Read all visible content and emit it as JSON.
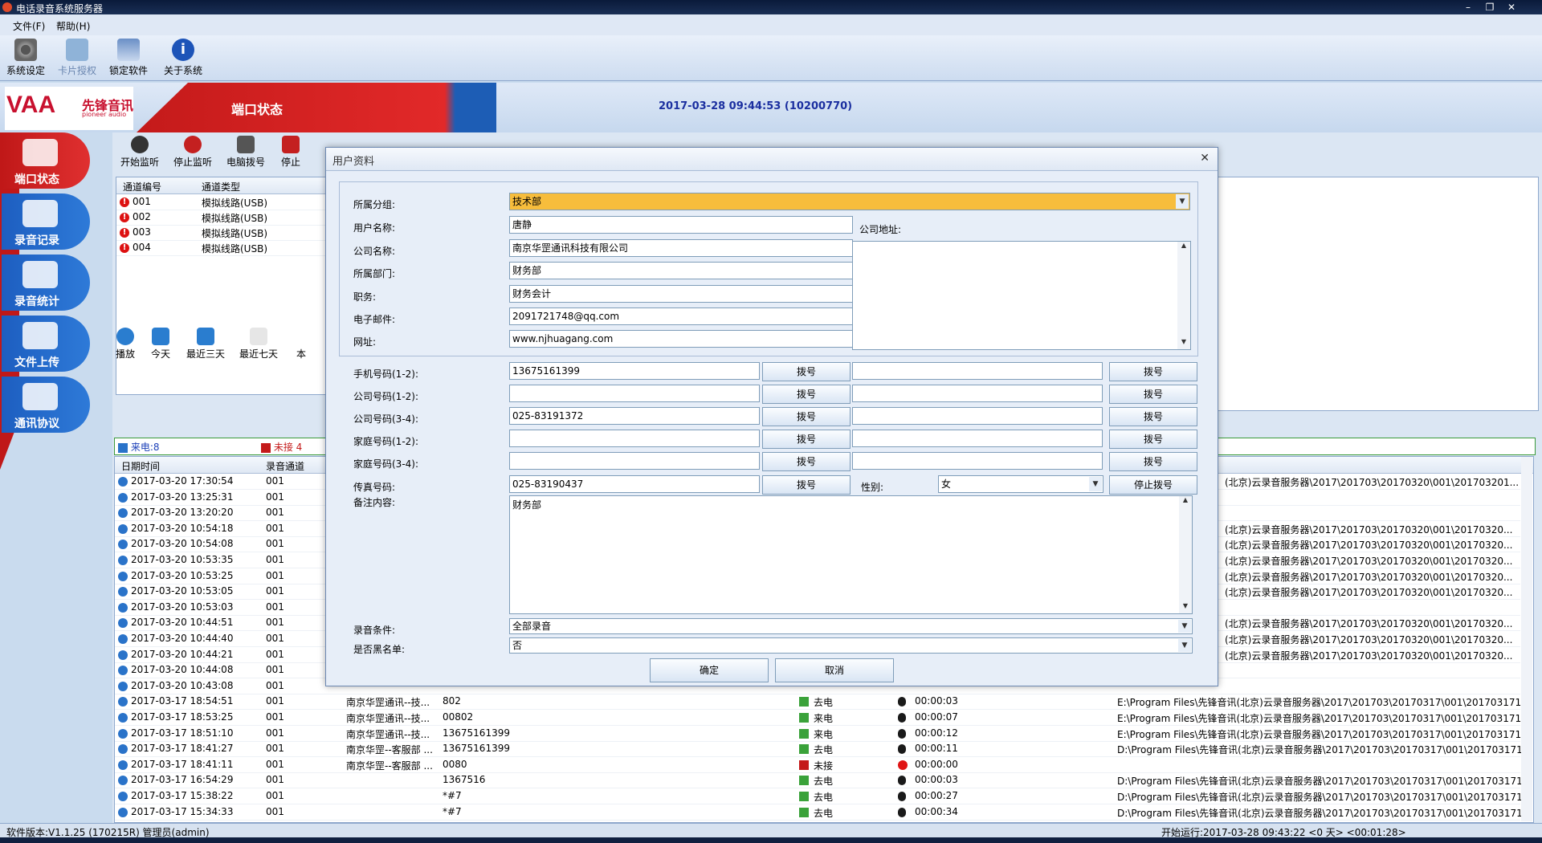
{
  "window": {
    "title": "电话录音系统服务器"
  },
  "menu": [
    "文件(F)",
    "帮助(H)"
  ],
  "toolbar": [
    {
      "label": "系统设定",
      "icon": "gear-icon",
      "enabled": true
    },
    {
      "label": "卡片授权",
      "icon": "card-icon",
      "enabled": false
    },
    {
      "label": "锁定软件",
      "icon": "lock-icon",
      "enabled": true
    },
    {
      "label": "关于系统",
      "icon": "info-icon",
      "enabled": true
    }
  ],
  "banner": {
    "logo": {
      "brand": "VAA",
      "cn": "先锋音讯",
      "en": "pioneer audio"
    },
    "title": "端口状态",
    "datetime": "2017-03-28 09:44:53 (10200770)"
  },
  "leftnav": [
    "端口状态",
    "录音记录",
    "录音统计",
    "文件上传",
    "通讯协议"
  ],
  "port_tools": [
    "开始监听",
    "停止监听",
    "电脑拨号",
    "停止"
  ],
  "channels": {
    "headers": [
      "通道编号",
      "通道类型"
    ],
    "rows": [
      {
        "id": "001",
        "type": "模拟线路(USB)"
      },
      {
        "id": "002",
        "type": "模拟线路(USB)"
      },
      {
        "id": "003",
        "type": "模拟线路(USB)"
      },
      {
        "id": "004",
        "type": "模拟线路(USB)"
      }
    ]
  },
  "record_tools": [
    "播放",
    "今天",
    "最近三天",
    "最近七天",
    "本"
  ],
  "record_filter": {
    "incoming": "来电:8",
    "missed": "未接 4"
  },
  "records": {
    "headers": [
      "日期时间",
      "录音通道"
    ],
    "rows": [
      {
        "dt": "2017-03-20 17:30:54",
        "ch": "001",
        "path": "(北京)云录音服务器\\2017\\201703\\20170320\\001\\201703201..."
      },
      {
        "dt": "2017-03-20 13:25:31",
        "ch": "001",
        "path": ""
      },
      {
        "dt": "2017-03-20 13:20:20",
        "ch": "001",
        "path": ""
      },
      {
        "dt": "2017-03-20 10:54:18",
        "ch": "001",
        "path": "(北京)云录音服务器\\2017\\201703\\20170320\\001\\20170320..."
      },
      {
        "dt": "2017-03-20 10:54:08",
        "ch": "001",
        "path": "(北京)云录音服务器\\2017\\201703\\20170320\\001\\20170320..."
      },
      {
        "dt": "2017-03-20 10:53:35",
        "ch": "001",
        "path": "(北京)云录音服务器\\2017\\201703\\20170320\\001\\20170320..."
      },
      {
        "dt": "2017-03-20 10:53:25",
        "ch": "001",
        "path": "(北京)云录音服务器\\2017\\201703\\20170320\\001\\20170320..."
      },
      {
        "dt": "2017-03-20 10:53:05",
        "ch": "001",
        "path": "(北京)云录音服务器\\2017\\201703\\20170320\\001\\20170320..."
      },
      {
        "dt": "2017-03-20 10:53:03",
        "ch": "001",
        "path": ""
      },
      {
        "dt": "2017-03-20 10:44:51",
        "ch": "001",
        "path": "(北京)云录音服务器\\2017\\201703\\20170320\\001\\20170320..."
      },
      {
        "dt": "2017-03-20 10:44:40",
        "ch": "001",
        "path": "(北京)云录音服务器\\2017\\201703\\20170320\\001\\20170320..."
      },
      {
        "dt": "2017-03-20 10:44:21",
        "ch": "001",
        "path": "(北京)云录音服务器\\2017\\201703\\20170320\\001\\20170320..."
      },
      {
        "dt": "2017-03-20 10:44:08",
        "ch": "001",
        "path": ""
      },
      {
        "dt": "2017-03-20 10:43:08",
        "ch": "001",
        "path": ""
      },
      {
        "dt": "2017-03-17 18:54:51",
        "ch": "001",
        "contact": "南京华罡通讯--技...",
        "num": "802",
        "dir": "去电",
        "dur": "00:00:03",
        "path": "E:\\Program Files\\先锋音讯(北京)云录音服务器\\2017\\201703\\20170317\\001\\201703171..."
      },
      {
        "dt": "2017-03-17 18:53:25",
        "ch": "001",
        "contact": "南京华罡通讯--技...",
        "num": "00802",
        "dir": "来电",
        "dur": "00:00:07",
        "path": "E:\\Program Files\\先锋音讯(北京)云录音服务器\\2017\\201703\\20170317\\001\\201703171..."
      },
      {
        "dt": "2017-03-17 18:51:10",
        "ch": "001",
        "contact": "南京华罡通讯--技...",
        "num": "13675161399",
        "dir": "来电",
        "dur": "00:00:12",
        "path": "E:\\Program Files\\先锋音讯(北京)云录音服务器\\2017\\201703\\20170317\\001\\201703171..."
      },
      {
        "dt": "2017-03-17 18:41:27",
        "ch": "001",
        "contact": "南京华罡--客服部 ...",
        "num": "13675161399",
        "dir": "去电",
        "dur": "00:00:11",
        "path": "D:\\Program Files\\先锋音讯(北京)云录音服务器\\2017\\201703\\20170317\\001\\201703171..."
      },
      {
        "dt": "2017-03-17 18:41:11",
        "ch": "001",
        "contact": "南京华罡--客服部 ...",
        "num": "0080",
        "dir": "未接",
        "dur": "00:00:00",
        "path": ""
      },
      {
        "dt": "2017-03-17 16:54:29",
        "ch": "001",
        "contact": "",
        "num": "1367516",
        "dir": "去电",
        "dur": "00:00:03",
        "path": "D:\\Program Files\\先锋音讯(北京)云录音服务器\\2017\\201703\\20170317\\001\\201703171..."
      },
      {
        "dt": "2017-03-17 15:38:22",
        "ch": "001",
        "contact": "",
        "num": "*#7",
        "dir": "去电",
        "dur": "00:00:27",
        "path": "D:\\Program Files\\先锋音讯(北京)云录音服务器\\2017\\201703\\20170317\\001\\201703171..."
      },
      {
        "dt": "2017-03-17 15:34:33",
        "ch": "001",
        "contact": "",
        "num": "*#7",
        "dir": "去电",
        "dur": "00:00:34",
        "path": "D:\\Program Files\\先锋音讯(北京)云录音服务器\\2017\\201703\\20170317\\001\\201703171..."
      }
    ]
  },
  "status": {
    "version": "软件版本:V1.1.25 (170215R) 管理员(admin)",
    "running": "开始运行:2017-03-28 09:43:22 <0 天> <00:01:28>"
  },
  "dialog": {
    "title": "用户资料",
    "group_label": "所属分组:",
    "group_value": "技术部",
    "name_label": "用户名称:",
    "name_value": "唐静",
    "company_label": "公司名称:",
    "company_value": "南京华罡通讯科技有限公司",
    "dept_label": "所属部门:",
    "dept_value": "财务部",
    "position_label": "职务:",
    "position_value": "财务会计",
    "email_label": "电子邮件:",
    "email_value": "2091721748@qq.com",
    "web_label": "网址:",
    "web_value": "www.njhuagang.com",
    "address_label": "公司地址:",
    "address_value": "",
    "phones": [
      {
        "label": "手机号码(1-2):",
        "v1": "13675161399",
        "v2": ""
      },
      {
        "label": "公司号码(1-2):",
        "v1": "",
        "v2": ""
      },
      {
        "label": "公司号码(3-4):",
        "v1": "025-83191372",
        "v2": ""
      },
      {
        "label": "家庭号码(1-2):",
        "v1": "",
        "v2": ""
      },
      {
        "label": "家庭号码(3-4):",
        "v1": "",
        "v2": ""
      }
    ],
    "dial_label": "拨号",
    "fax_label": "传真号码:",
    "fax_value": "025-83190437",
    "gender_label": "性别:",
    "gender_value": "女",
    "stop_dial_label": "停止拨号",
    "notes_label": "备注内容:",
    "notes_value": "财务部",
    "record_cond_label": "录音条件:",
    "record_cond_value": "全部录音",
    "blacklist_label": "是否黑名单:",
    "blacklist_value": "否",
    "ok_label": "确定",
    "cancel_label": "取消"
  },
  "colors": {
    "accent_red": "#c8102e",
    "group_highlight": "#f7bd3c",
    "datetime_blue": "#1b2fa0"
  }
}
